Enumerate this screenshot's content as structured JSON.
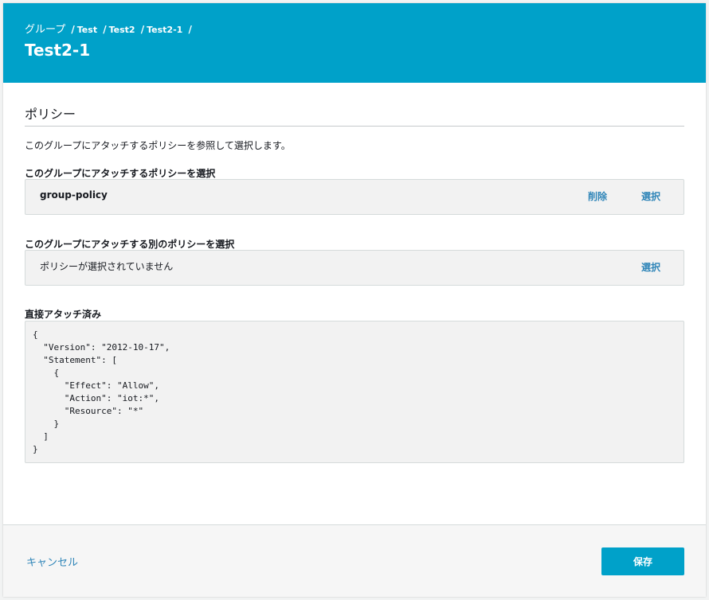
{
  "header": {
    "breadcrumb": {
      "root": "グループ",
      "separator": "/",
      "items": [
        "Test",
        "Test2",
        "Test2-1"
      ]
    },
    "title": "Test2-1"
  },
  "section": {
    "title": "ポリシー",
    "description": "このグループにアタッチするポリシーを参照して選択します。"
  },
  "primary_policy": {
    "label": "このグループにアタッチするポリシーを選択",
    "name": "group-policy",
    "delete_label": "削除",
    "select_label": "選択"
  },
  "additional_policy": {
    "label": "このグループにアタッチする別のポリシーを選択",
    "empty_text": "ポリシーが選択されていません",
    "select_label": "選択"
  },
  "direct_attached": {
    "label": "直接アタッチ済み",
    "code": "{\n  \"Version\": \"2012-10-17\",\n  \"Statement\": [\n    {\n      \"Effect\": \"Allow\",\n      \"Action\": \"iot:*\",\n      \"Resource\": \"*\"\n    }\n  ]\n}"
  },
  "footer": {
    "cancel_label": "キャンセル",
    "save_label": "保存"
  },
  "colors": {
    "header_bg": "#00a1c9",
    "link": "#2f85b8",
    "primary_button": "#00a1c9"
  }
}
